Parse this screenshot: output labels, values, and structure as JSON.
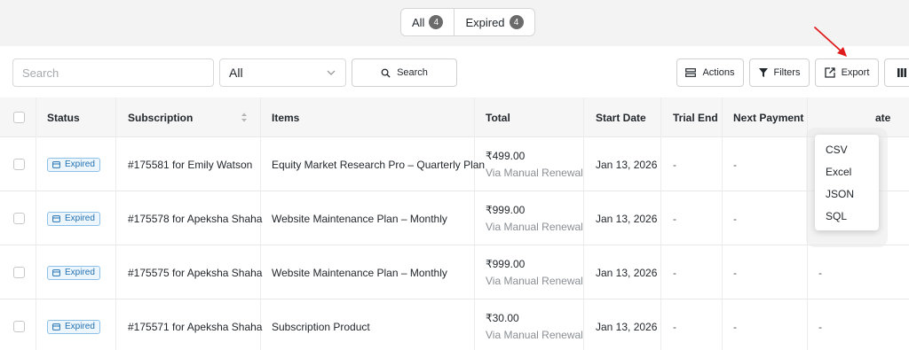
{
  "status_tabs": [
    {
      "label": "All",
      "count": "4"
    },
    {
      "label": "Expired",
      "count": "4"
    }
  ],
  "toolbar": {
    "search_placeholder": "Search",
    "status_select_value": "All",
    "search_button": "Search",
    "actions_button": "Actions",
    "filters_button": "Filters",
    "export_button": "Export"
  },
  "export_menu": [
    "CSV",
    "Excel",
    "JSON",
    "SQL"
  ],
  "table": {
    "columns": [
      "Status",
      "Subscription",
      "Items",
      "Total",
      "Start Date",
      "Trial End",
      "Next Payment",
      "ate"
    ],
    "rows": [
      {
        "status": "Expired",
        "subscription": "#175581 for Emily Watson",
        "items": "Equity Market Research Pro – Quarterly Plan",
        "total": "₹499.00",
        "via": "Via Manual Renewal",
        "start_date": "Jan 13, 2026",
        "trial_end": "-",
        "next_payment": "-",
        "last": ""
      },
      {
        "status": "Expired",
        "subscription": "#175578 for Apeksha Shaha",
        "items": "Website Maintenance Plan – Monthly",
        "total": "₹999.00",
        "via": "Via Manual Renewal",
        "start_date": "Jan 13, 2026",
        "trial_end": "-",
        "next_payment": "-",
        "last": "-"
      },
      {
        "status": "Expired",
        "subscription": "#175575 for Apeksha Shaha",
        "items": "Website Maintenance Plan – Monthly",
        "total": "₹999.00",
        "via": "Via Manual Renewal",
        "start_date": "Jan 13, 2026",
        "trial_end": "-",
        "next_payment": "-",
        "last": "-"
      },
      {
        "status": "Expired",
        "subscription": "#175571 for Apeksha Shaha",
        "items": "Subscription Product",
        "total": "₹30.00",
        "via": "Via Manual Renewal",
        "start_date": "Jan 13, 2026",
        "trial_end": "-",
        "next_payment": "-",
        "last": "-"
      }
    ]
  },
  "colors": {
    "badge_blue": "#2271b1",
    "annotation_arrow": "#e01b1b"
  }
}
